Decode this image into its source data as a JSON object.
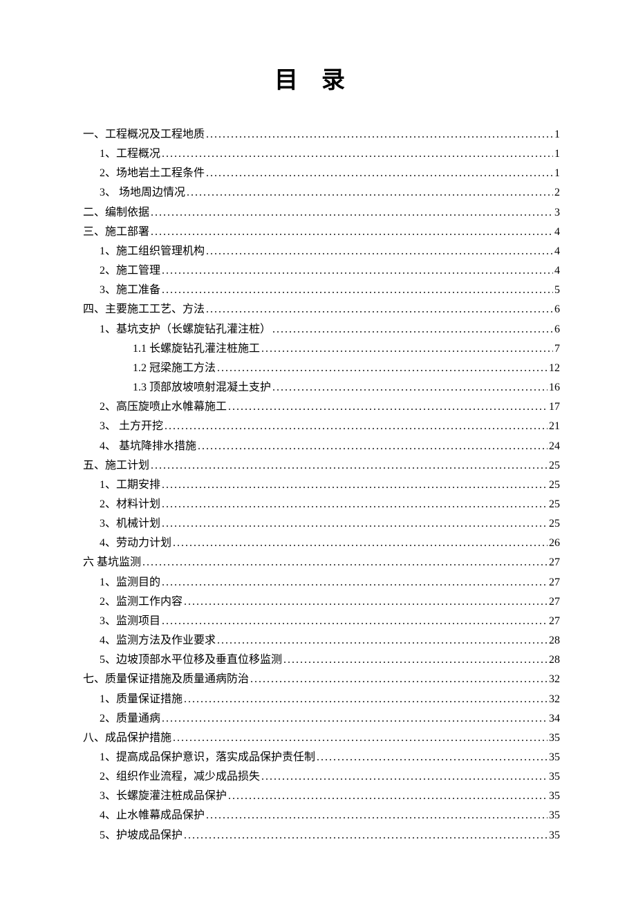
{
  "title": "目录",
  "entries": [
    {
      "indent": 0,
      "label": "一、工程概况及工程地质",
      "page": "1"
    },
    {
      "indent": 1,
      "label": "1、工程概况 ",
      "page": "1"
    },
    {
      "indent": 1,
      "label": "2、场地岩土工程条件 ",
      "page": "1"
    },
    {
      "indent": 1,
      "label": "3、 场地周边情况",
      "page": "2"
    },
    {
      "indent": 0,
      "label": "二、编制依据",
      "page": "3"
    },
    {
      "indent": 0,
      "label": "三、施工部署",
      "page": "4"
    },
    {
      "indent": 1,
      "label": "1、施工组织管理机构 ",
      "page": "4"
    },
    {
      "indent": 1,
      "label": "2、施工管理 ",
      "page": "4"
    },
    {
      "indent": 1,
      "label": "3、施工准备 ",
      "page": "5"
    },
    {
      "indent": 0,
      "label": "四、主要施工工艺、方法",
      "page": "6"
    },
    {
      "indent": 1,
      "label": "1、基坑支护（长螺旋钻孔灌注桩） ",
      "page": "6"
    },
    {
      "indent": 2,
      "label": "1.1 长螺旋钻孔灌注桩施工",
      "page": "7"
    },
    {
      "indent": 2,
      "label": "1.2 冠梁施工方法",
      "page": "12"
    },
    {
      "indent": 2,
      "label": "1.3 顶部放坡喷射混凝土支护",
      "page": "16"
    },
    {
      "indent": 1,
      "label": "2、高压旋喷止水帷幕施工 ",
      "page": "17"
    },
    {
      "indent": 1,
      "label": "3、 土方开挖",
      "page": "21"
    },
    {
      "indent": 1,
      "label": "4、 基坑降排水措施",
      "page": "24"
    },
    {
      "indent": 0,
      "label": "五、施工计划",
      "page": "25"
    },
    {
      "indent": 1,
      "label": "1、工期安排 ",
      "page": "25"
    },
    {
      "indent": 1,
      "label": "2、材料计划 ",
      "page": "25"
    },
    {
      "indent": 1,
      "label": "3、机械计划 ",
      "page": "25"
    },
    {
      "indent": 1,
      "label": "4、劳动力计划 ",
      "page": "26"
    },
    {
      "indent": 0,
      "label": "六  基坑监测",
      "page": "27"
    },
    {
      "indent": 1,
      "label": "1、监测目的 ",
      "page": "27"
    },
    {
      "indent": 1,
      "label": "2、监测工作内容 ",
      "page": "27"
    },
    {
      "indent": 1,
      "label": "3、监测项目 ",
      "page": "27"
    },
    {
      "indent": 1,
      "label": "4、监测方法及作业要求 ",
      "page": "28"
    },
    {
      "indent": 1,
      "label": "5、边坡顶部水平位移及垂直位移监测 ",
      "page": "28"
    },
    {
      "indent": 0,
      "label": "七、质量保证措施及质量通病防治",
      "page": "32"
    },
    {
      "indent": 1,
      "label": "1、质量保证措施 ",
      "page": "32"
    },
    {
      "indent": 1,
      "label": "2、质量通病 ",
      "page": "34"
    },
    {
      "indent": 0,
      "label": "八、成品保护措施",
      "page": "35"
    },
    {
      "indent": 1,
      "label": "1、提高成品保护意识，落实成品保护责任制 ",
      "page": "35"
    },
    {
      "indent": 1,
      "label": "2、组织作业流程，减少成品损失 ",
      "page": "35"
    },
    {
      "indent": 1,
      "label": "3、长螺旋灌注桩成品保护 ",
      "page": "35"
    },
    {
      "indent": 1,
      "label": "4、止水帷幕成品保护 ",
      "page": "35"
    },
    {
      "indent": 1,
      "label": "5、护坡成品保护 ",
      "page": "35"
    }
  ]
}
